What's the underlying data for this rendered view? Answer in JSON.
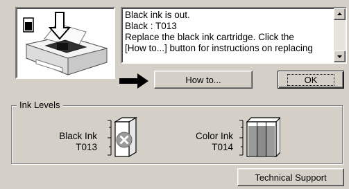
{
  "message": {
    "lines": [
      "Black ink is out.",
      "Black : T013",
      "Replace the black ink cartridge. Click the",
      "[How to...] button for instructions on replacing"
    ]
  },
  "buttons": {
    "how_to_label": "How to...",
    "ok_label": "OK",
    "tech_support_label": "Technical Support"
  },
  "ink_levels": {
    "group_label": "Ink Levels",
    "black": {
      "name": "Black Ink",
      "code": "T013",
      "status": "empty",
      "level": 0
    },
    "color": {
      "name": "Color Ink",
      "code": "T014",
      "level": 0.85
    }
  },
  "icons": {
    "printer": "printer-illustration-icon",
    "arrow": "arrow-right-icon",
    "empty": "empty-x-icon"
  }
}
